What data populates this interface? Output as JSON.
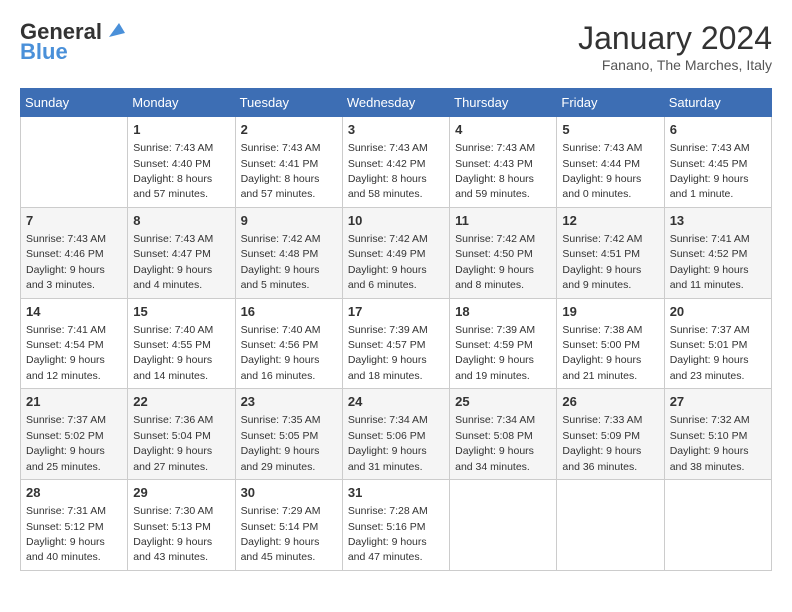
{
  "header": {
    "logo_line1": "General",
    "logo_line2": "Blue",
    "month": "January 2024",
    "location": "Fanano, The Marches, Italy"
  },
  "days_of_week": [
    "Sunday",
    "Monday",
    "Tuesday",
    "Wednesday",
    "Thursday",
    "Friday",
    "Saturday"
  ],
  "weeks": [
    [
      {
        "day": "",
        "info": ""
      },
      {
        "day": "1",
        "info": "Sunrise: 7:43 AM\nSunset: 4:40 PM\nDaylight: 8 hours\nand 57 minutes."
      },
      {
        "day": "2",
        "info": "Sunrise: 7:43 AM\nSunset: 4:41 PM\nDaylight: 8 hours\nand 57 minutes."
      },
      {
        "day": "3",
        "info": "Sunrise: 7:43 AM\nSunset: 4:42 PM\nDaylight: 8 hours\nand 58 minutes."
      },
      {
        "day": "4",
        "info": "Sunrise: 7:43 AM\nSunset: 4:43 PM\nDaylight: 8 hours\nand 59 minutes."
      },
      {
        "day": "5",
        "info": "Sunrise: 7:43 AM\nSunset: 4:44 PM\nDaylight: 9 hours\nand 0 minutes."
      },
      {
        "day": "6",
        "info": "Sunrise: 7:43 AM\nSunset: 4:45 PM\nDaylight: 9 hours\nand 1 minute."
      }
    ],
    [
      {
        "day": "7",
        "info": "Sunrise: 7:43 AM\nSunset: 4:46 PM\nDaylight: 9 hours\nand 3 minutes."
      },
      {
        "day": "8",
        "info": "Sunrise: 7:43 AM\nSunset: 4:47 PM\nDaylight: 9 hours\nand 4 minutes."
      },
      {
        "day": "9",
        "info": "Sunrise: 7:42 AM\nSunset: 4:48 PM\nDaylight: 9 hours\nand 5 minutes."
      },
      {
        "day": "10",
        "info": "Sunrise: 7:42 AM\nSunset: 4:49 PM\nDaylight: 9 hours\nand 6 minutes."
      },
      {
        "day": "11",
        "info": "Sunrise: 7:42 AM\nSunset: 4:50 PM\nDaylight: 9 hours\nand 8 minutes."
      },
      {
        "day": "12",
        "info": "Sunrise: 7:42 AM\nSunset: 4:51 PM\nDaylight: 9 hours\nand 9 minutes."
      },
      {
        "day": "13",
        "info": "Sunrise: 7:41 AM\nSunset: 4:52 PM\nDaylight: 9 hours\nand 11 minutes."
      }
    ],
    [
      {
        "day": "14",
        "info": "Sunrise: 7:41 AM\nSunset: 4:54 PM\nDaylight: 9 hours\nand 12 minutes."
      },
      {
        "day": "15",
        "info": "Sunrise: 7:40 AM\nSunset: 4:55 PM\nDaylight: 9 hours\nand 14 minutes."
      },
      {
        "day": "16",
        "info": "Sunrise: 7:40 AM\nSunset: 4:56 PM\nDaylight: 9 hours\nand 16 minutes."
      },
      {
        "day": "17",
        "info": "Sunrise: 7:39 AM\nSunset: 4:57 PM\nDaylight: 9 hours\nand 18 minutes."
      },
      {
        "day": "18",
        "info": "Sunrise: 7:39 AM\nSunset: 4:59 PM\nDaylight: 9 hours\nand 19 minutes."
      },
      {
        "day": "19",
        "info": "Sunrise: 7:38 AM\nSunset: 5:00 PM\nDaylight: 9 hours\nand 21 minutes."
      },
      {
        "day": "20",
        "info": "Sunrise: 7:37 AM\nSunset: 5:01 PM\nDaylight: 9 hours\nand 23 minutes."
      }
    ],
    [
      {
        "day": "21",
        "info": "Sunrise: 7:37 AM\nSunset: 5:02 PM\nDaylight: 9 hours\nand 25 minutes."
      },
      {
        "day": "22",
        "info": "Sunrise: 7:36 AM\nSunset: 5:04 PM\nDaylight: 9 hours\nand 27 minutes."
      },
      {
        "day": "23",
        "info": "Sunrise: 7:35 AM\nSunset: 5:05 PM\nDaylight: 9 hours\nand 29 minutes."
      },
      {
        "day": "24",
        "info": "Sunrise: 7:34 AM\nSunset: 5:06 PM\nDaylight: 9 hours\nand 31 minutes."
      },
      {
        "day": "25",
        "info": "Sunrise: 7:34 AM\nSunset: 5:08 PM\nDaylight: 9 hours\nand 34 minutes."
      },
      {
        "day": "26",
        "info": "Sunrise: 7:33 AM\nSunset: 5:09 PM\nDaylight: 9 hours\nand 36 minutes."
      },
      {
        "day": "27",
        "info": "Sunrise: 7:32 AM\nSunset: 5:10 PM\nDaylight: 9 hours\nand 38 minutes."
      }
    ],
    [
      {
        "day": "28",
        "info": "Sunrise: 7:31 AM\nSunset: 5:12 PM\nDaylight: 9 hours\nand 40 minutes."
      },
      {
        "day": "29",
        "info": "Sunrise: 7:30 AM\nSunset: 5:13 PM\nDaylight: 9 hours\nand 43 minutes."
      },
      {
        "day": "30",
        "info": "Sunrise: 7:29 AM\nSunset: 5:14 PM\nDaylight: 9 hours\nand 45 minutes."
      },
      {
        "day": "31",
        "info": "Sunrise: 7:28 AM\nSunset: 5:16 PM\nDaylight: 9 hours\nand 47 minutes."
      },
      {
        "day": "",
        "info": ""
      },
      {
        "day": "",
        "info": ""
      },
      {
        "day": "",
        "info": ""
      }
    ]
  ]
}
